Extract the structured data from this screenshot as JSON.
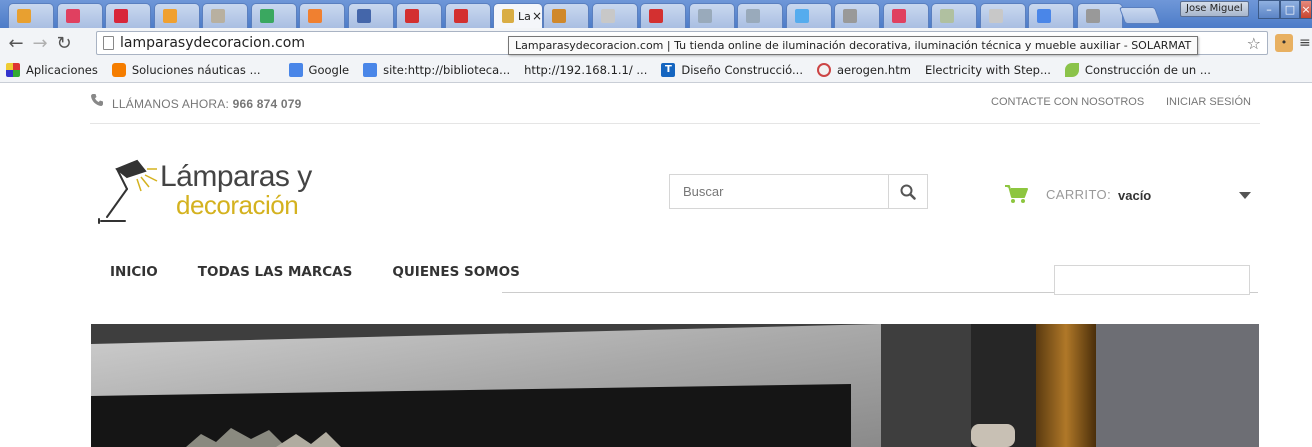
{
  "browser": {
    "tabs": [
      {
        "color": "#e8a030"
      },
      {
        "color": "#e04060"
      },
      {
        "color": "#d8263a"
      },
      {
        "color": "#f0a030"
      },
      {
        "color": "#b8b0a0"
      },
      {
        "color": "#3aa860"
      },
      {
        "color": "#f08030"
      },
      {
        "color": "#4466aa"
      },
      {
        "color": "#d33030"
      },
      {
        "color": "#d33030"
      },
      {
        "color": "#d9ad44",
        "title": "La",
        "active": true
      },
      {
        "color": "#d0882a"
      },
      {
        "color": "#c8c8c8"
      },
      {
        "color": "#d33030"
      },
      {
        "color": "#9ab"
      },
      {
        "color": "#9ab"
      },
      {
        "color": "#55acee"
      },
      {
        "color": "#999"
      },
      {
        "color": "#e04060"
      },
      {
        "color": "#b0c0a0"
      },
      {
        "color": "#c8c8c8"
      },
      {
        "color": "#4a86e8"
      },
      {
        "color": "#999"
      }
    ],
    "profile_name": "Jose Miguel",
    "url": "lamparasydecoracion.com",
    "tooltip": "Lamparasydecoracion.com | Tu tienda online de iluminación decorativa, iluminación técnica y mueble auxiliar - SOLARMAT"
  },
  "bookmarks": [
    {
      "icon": "apps",
      "label": "Aplicaciones"
    },
    {
      "icon": "blogger",
      "label": "Soluciones náuticas ..."
    },
    {
      "icon": "page",
      "label": ""
    },
    {
      "icon": "google",
      "label": "Google"
    },
    {
      "icon": "google",
      "label": "site:http://biblioteca..."
    },
    {
      "icon": "page",
      "label": "http://192.168.1.1/ ..."
    },
    {
      "icon": "tdoc",
      "label": "Diseño Construcció..."
    },
    {
      "icon": "gsite",
      "label": "aerogen.htm"
    },
    {
      "icon": "page",
      "label": "Electricity with Step..."
    },
    {
      "icon": "leaf",
      "label": "Construcción de un ..."
    }
  ],
  "site": {
    "call_label": "LLÁMANOS AHORA:",
    "phone": "966 874 079",
    "contact_link": "CONTACTE CON NOSOTROS",
    "signin_link": "INICIAR SESIÓN",
    "logo_line1": "Lámparas y",
    "logo_line2": "decoración",
    "search_placeholder": "Buscar",
    "cart_label": "CARRITO:",
    "cart_value": "vacío",
    "menu": [
      "INICIO",
      "TODAS LAS MARCAS",
      "QUIENES SOMOS"
    ],
    "colors": {
      "accent_green": "#8dc63f",
      "logo_gold": "#d4b21f"
    }
  }
}
